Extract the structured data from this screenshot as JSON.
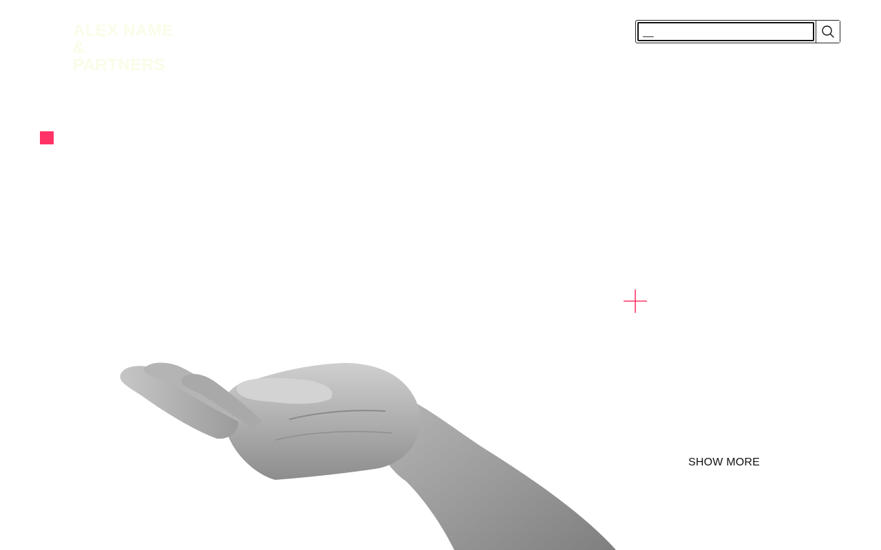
{
  "header": {
    "logo_line1": "ALEX NAME &",
    "logo_line2": "PARTNERS",
    "logo_color": "#FBFCE8"
  },
  "search": {
    "placeholder": "__",
    "icon": "search-icon"
  },
  "decor": {
    "accent_color": "#FF3366",
    "square_icon": "square",
    "plus_icon": "plus-icon"
  },
  "hero": {
    "image": "grayscale open hand, palm up"
  },
  "actions": {
    "show_more_label": "SHOW MORE"
  }
}
